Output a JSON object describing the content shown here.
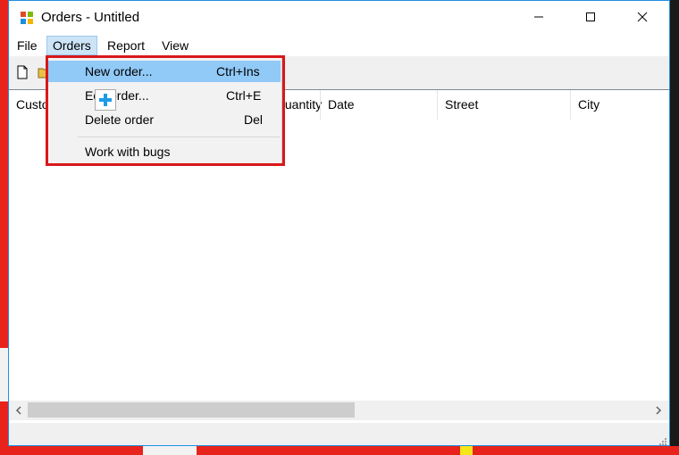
{
  "window": {
    "title": "Orders - Untitled"
  },
  "icons": {
    "app": "app-icon",
    "minimize": "minimize-icon",
    "maximize": "maximize-icon",
    "close": "close-icon",
    "new": "new-document-icon",
    "open": "open-folder-icon",
    "cursor": "add-cursor-icon"
  },
  "menubar": {
    "file": "File",
    "orders": "Orders",
    "report": "Report",
    "view": "View"
  },
  "orders_menu": {
    "items": [
      {
        "label": "New order...",
        "shortcut": "Ctrl+Ins"
      },
      {
        "label": "Edit order...",
        "shortcut": "Ctrl+E"
      },
      {
        "label": "Delete order",
        "shortcut": "Del"
      },
      {
        "label": "Work with bugs",
        "shortcut": ""
      }
    ]
  },
  "list": {
    "columns": [
      "Customer",
      "Quantity",
      "Date",
      "Street",
      "City"
    ]
  },
  "colors": {
    "accent_border": "#1e8fe0",
    "highlight_box": "#d9171b",
    "menu_hover": "#91c9f7"
  }
}
